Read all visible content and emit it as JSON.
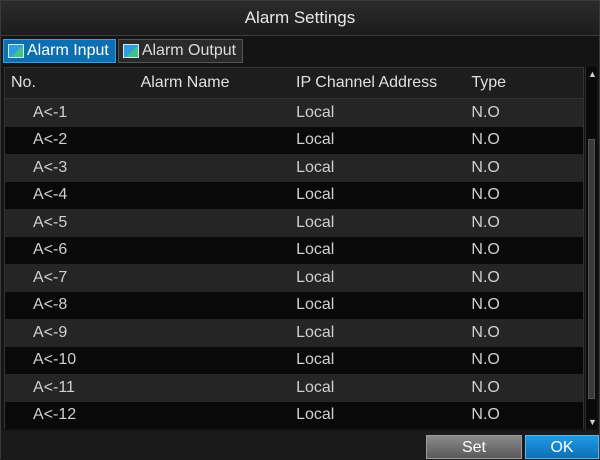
{
  "window": {
    "title": "Alarm Settings"
  },
  "tabs": [
    {
      "label": "Alarm Input",
      "icon": "alarm-input-icon",
      "active": true
    },
    {
      "label": "Alarm Output",
      "icon": "alarm-output-icon",
      "active": false
    }
  ],
  "table": {
    "columns": [
      "No.",
      "Alarm Name",
      "IP Channel Address",
      "Type"
    ],
    "rows": [
      {
        "no": "A<-1",
        "name": "",
        "ip": "Local",
        "type": "N.O"
      },
      {
        "no": "A<-2",
        "name": "",
        "ip": "Local",
        "type": "N.O"
      },
      {
        "no": "A<-3",
        "name": "",
        "ip": "Local",
        "type": "N.O"
      },
      {
        "no": "A<-4",
        "name": "",
        "ip": "Local",
        "type": "N.O"
      },
      {
        "no": "A<-5",
        "name": "",
        "ip": "Local",
        "type": "N.O"
      },
      {
        "no": "A<-6",
        "name": "",
        "ip": "Local",
        "type": "N.O"
      },
      {
        "no": "A<-7",
        "name": "",
        "ip": "Local",
        "type": "N.O"
      },
      {
        "no": "A<-8",
        "name": "",
        "ip": "Local",
        "type": "N.O"
      },
      {
        "no": "A<-9",
        "name": "",
        "ip": "Local",
        "type": "N.O"
      },
      {
        "no": "A<-10",
        "name": "",
        "ip": "Local",
        "type": "N.O"
      },
      {
        "no": "A<-11",
        "name": "",
        "ip": "Local",
        "type": "N.O"
      },
      {
        "no": "A<-12",
        "name": "",
        "ip": "Local",
        "type": "N.O"
      }
    ]
  },
  "buttons": {
    "set_label": "Set",
    "ok_label": "OK"
  },
  "colors": {
    "accent": "#0e6fb0",
    "background": "#141414",
    "row_alt": "#252525"
  }
}
